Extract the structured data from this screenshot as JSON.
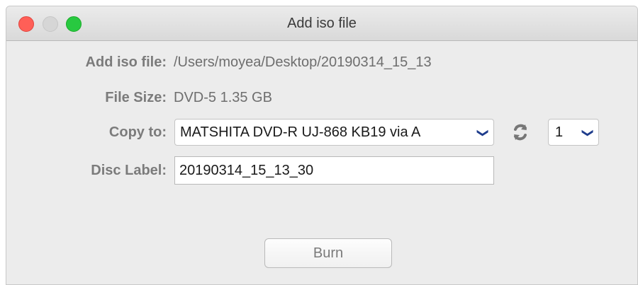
{
  "window": {
    "title": "Add iso file"
  },
  "form": {
    "iso_label": "Add iso file:",
    "iso_path": "/Users/moyea/Desktop/20190314_15_13",
    "size_label": "File Size:",
    "size_value": "DVD-5 1.35 GB",
    "copy_label": "Copy to:",
    "copy_device": "MATSHITA DVD-R   UJ-868 KB19 via A",
    "copy_count": "1",
    "disc_label": "Disc Label:",
    "disc_value": "20190314_15_13_30"
  },
  "actions": {
    "burn_label": "Burn"
  },
  "icons": {
    "dropdown": "chevron-down-icon",
    "refresh": "refresh-icon"
  },
  "colors": {
    "close": "#ff5f57",
    "minimize": "#d6d6d6",
    "zoom": "#28c940",
    "chevron": "#1e3c8c"
  }
}
